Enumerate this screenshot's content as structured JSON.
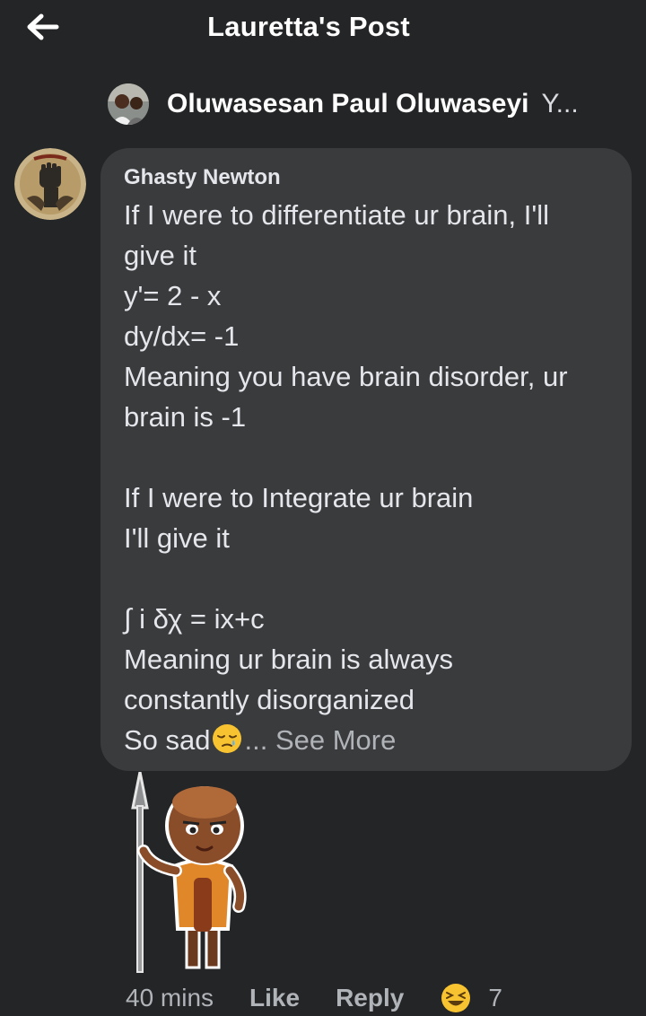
{
  "header": {
    "title": "Lauretta's Post"
  },
  "reply_context": {
    "name": "Oluwasesan Paul Oluwaseyi",
    "snippet": "Y..."
  },
  "comment": {
    "author": "Ghasty Newton",
    "lines": [
      "If I were to differentiate ur brain, I'll",
      "give it",
      "y'= 2 - x",
      "dy/dx= -1",
      "Meaning you have brain disorder, ur",
      "brain is -1",
      "",
      "If I were to Integrate ur brain",
      "I'll give it",
      "",
      "∫ i δχ = ix+c",
      "Meaning ur brain is always",
      "constantly disorganized"
    ],
    "last_line_text": "So sad",
    "last_line_emoji": "sleepy-face-emoji",
    "see_more": "... See More"
  },
  "actions": {
    "time": "40 mins",
    "like": "Like",
    "reply": "Reply",
    "reaction_emoji": "grinning-squinting-face-emoji",
    "reaction_count": "7"
  },
  "colors": {
    "background": "#242526",
    "bubble": "#3a3b3c",
    "text": "#e4e6eb",
    "muted": "#b0b3b8"
  }
}
